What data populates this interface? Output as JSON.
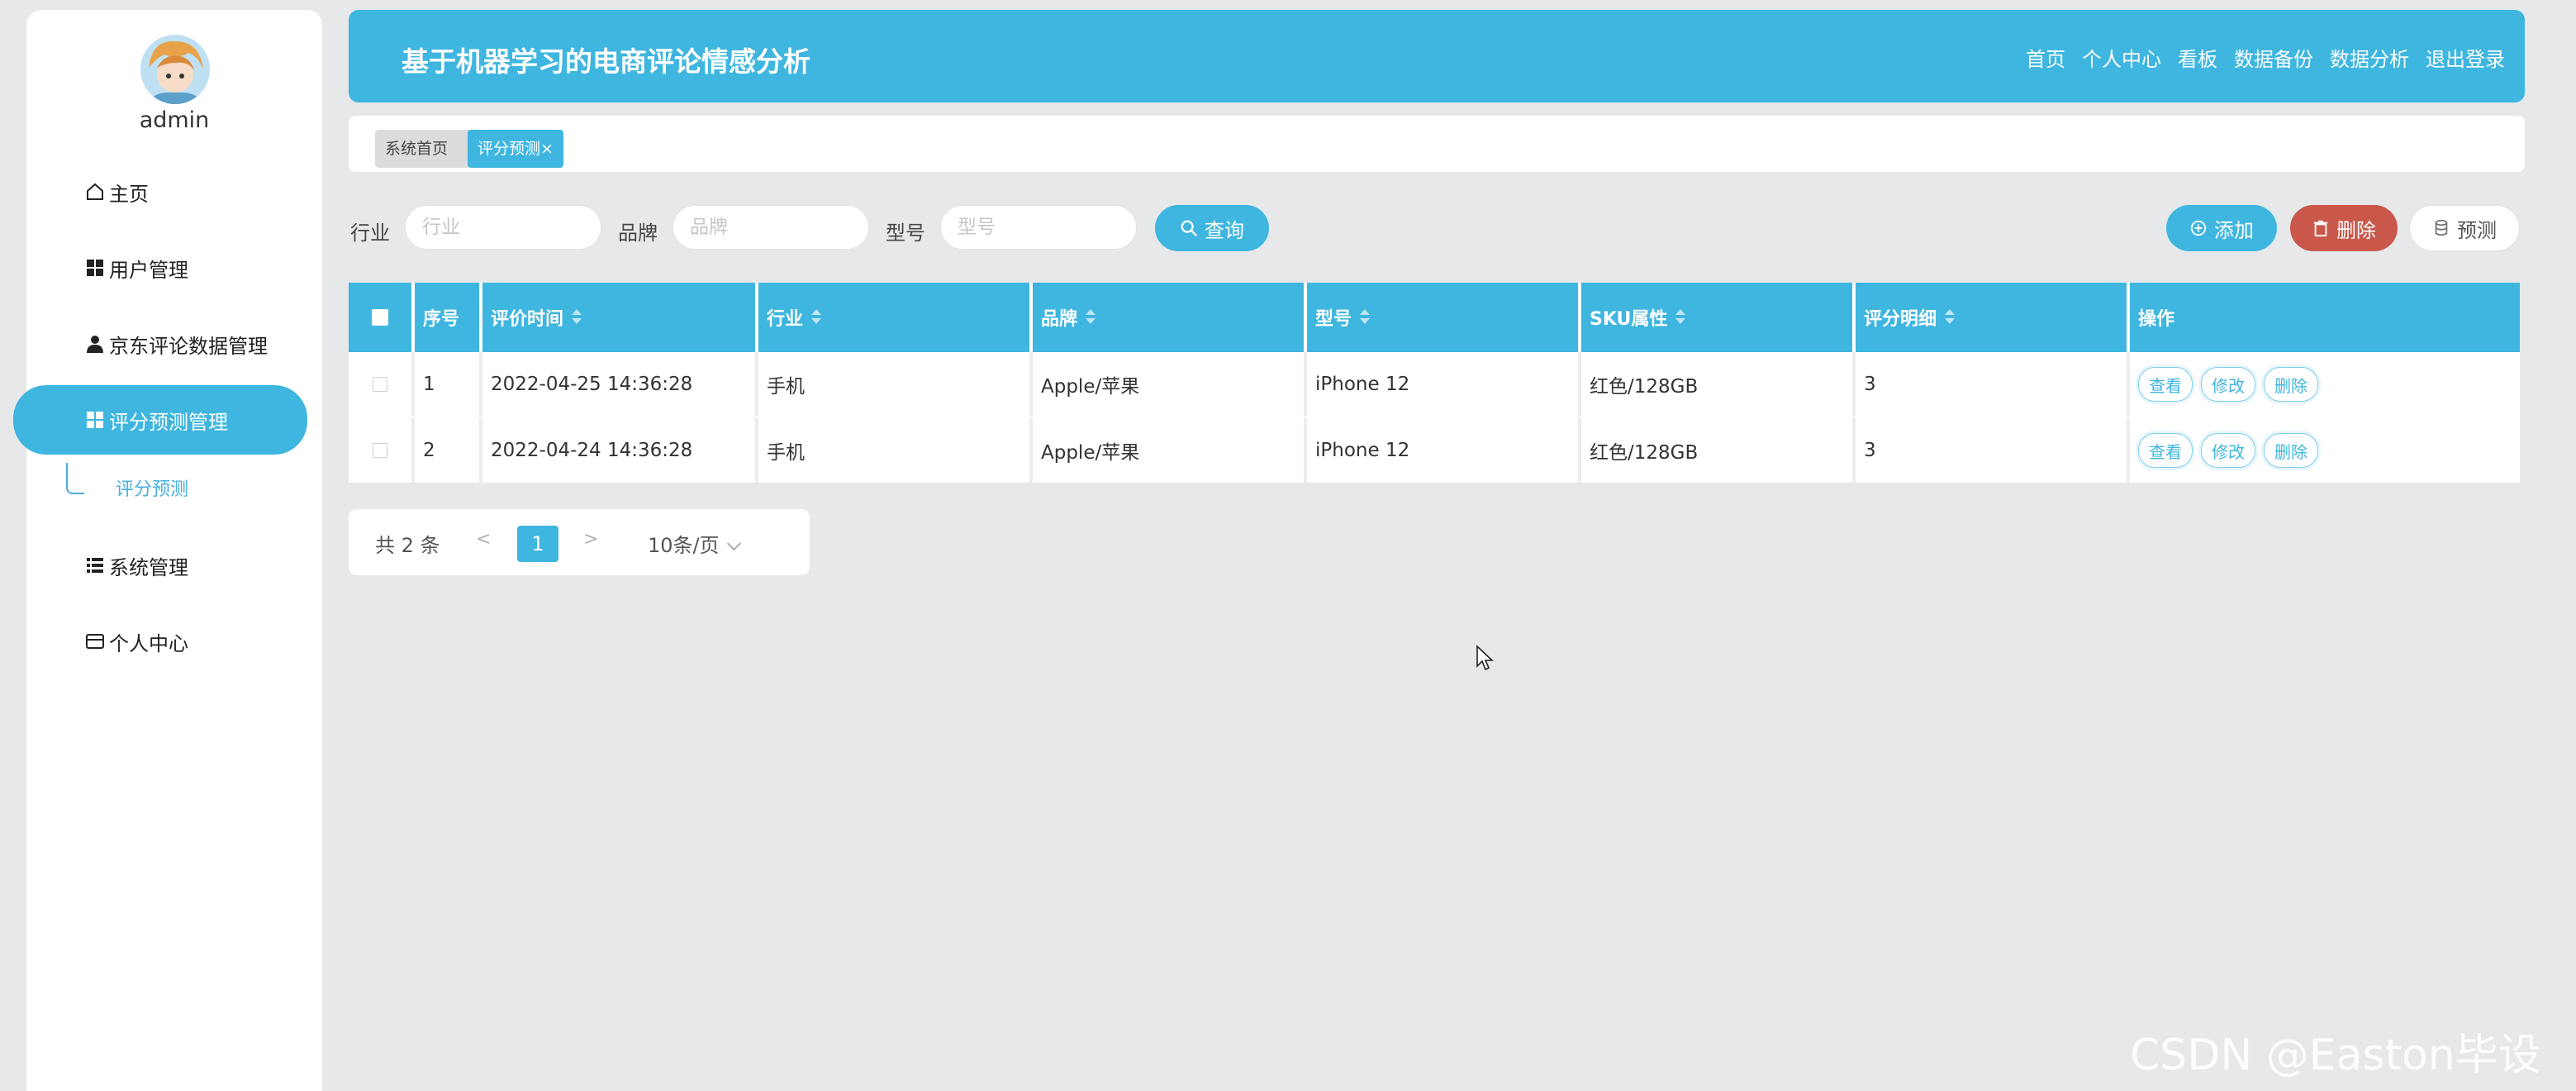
{
  "sidebar": {
    "username": "admin",
    "items": [
      {
        "label": "主页",
        "icon": "home-icon"
      },
      {
        "label": "用户管理",
        "icon": "grid-icon"
      },
      {
        "label": "京东评论数据管理",
        "icon": "user-icon"
      },
      {
        "label": "评分预测管理",
        "icon": "grid-icon"
      },
      {
        "label": "系统管理",
        "icon": "list-icon"
      },
      {
        "label": "个人中心",
        "icon": "card-icon"
      }
    ],
    "sub_item": "评分预测"
  },
  "header": {
    "title": "基于机器学习的电商评论情感分析",
    "links": [
      "首页",
      "个人中心",
      "看板",
      "数据备份",
      "数据分析",
      "退出登录"
    ]
  },
  "tabs": {
    "home": "系统首页",
    "current": "评分预测",
    "close": "×"
  },
  "search": {
    "industry_label": "行业",
    "industry_placeholder": "行业",
    "brand_label": "品牌",
    "brand_placeholder": "品牌",
    "model_label": "型号",
    "model_placeholder": "型号",
    "query_button": "查询"
  },
  "actions": {
    "add": "添加",
    "delete": "删除",
    "predict": "预测"
  },
  "table": {
    "columns": [
      "序号",
      "评价时间",
      "行业",
      "品牌",
      "型号",
      "SKU属性",
      "评分明细",
      "操作"
    ],
    "rows": [
      {
        "index": "1",
        "time": "2022-04-25 14:36:28",
        "industry": "手机",
        "brand": "Apple/苹果",
        "model": "iPhone 12",
        "sku": "红色/128GB",
        "score": "3"
      },
      {
        "index": "2",
        "time": "2022-04-24 14:36:28",
        "industry": "手机",
        "brand": "Apple/苹果",
        "model": "iPhone 12",
        "sku": "红色/128GB",
        "score": "3"
      }
    ],
    "row_actions": [
      "查看",
      "修改",
      "删除"
    ]
  },
  "pagination": {
    "total": "共 2 条",
    "prev": "<",
    "current": "1",
    "next": ">",
    "page_size": "10条/页"
  },
  "watermark": "CSDN @Easton毕设",
  "colors": {
    "accent": "#3fb6df",
    "danger": "#c9574a",
    "background": "#e6e8ea"
  }
}
